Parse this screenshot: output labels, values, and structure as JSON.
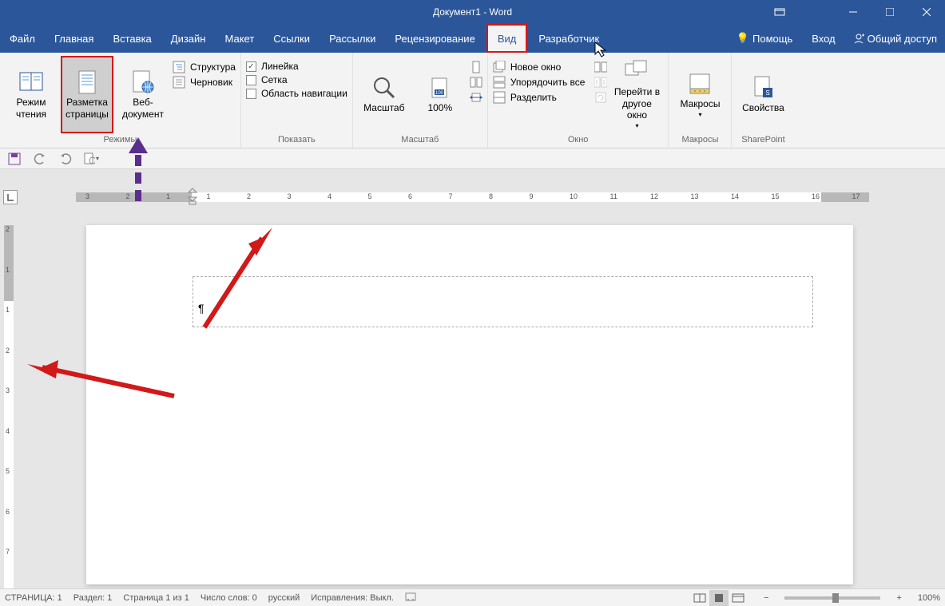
{
  "title": "Документ1 - Word",
  "menutabs": {
    "file": "Файл",
    "home": "Главная",
    "insert": "Вставка",
    "design": "Дизайн",
    "layout": "Макет",
    "references": "Ссылки",
    "mailings": "Рассылки",
    "review": "Рецензирование",
    "view": "Вид",
    "developer": "Разработчик"
  },
  "menuright": {
    "help": "Помощь",
    "login": "Вход",
    "share": "Общий доступ"
  },
  "ribbon": {
    "views_group_label": "Режимы",
    "read_mode": "Режим чтения",
    "print_layout": "Разметка страницы",
    "web_layout": "Веб-документ",
    "outline": "Структура",
    "draft": "Черновик",
    "show_group_label": "Показать",
    "ruler": "Линейка",
    "gridlines": "Сетка",
    "nav_pane": "Область навигации",
    "zoom_group_label": "Масштаб",
    "zoom": "Масштаб",
    "hundred": "100%",
    "window_group_label": "Окно",
    "new_window": "Новое окно",
    "arrange_all": "Упорядочить все",
    "split": "Разделить",
    "switch_windows": "Перейти в другое окно",
    "macros_label": "Макросы",
    "macros_group": "Макросы",
    "sharepoint_label": "Свойства",
    "sharepoint_group": "SharePoint"
  },
  "ruler_h": [
    "3",
    "2",
    "1",
    "1",
    "2",
    "3",
    "4",
    "5",
    "6",
    "7",
    "8",
    "9",
    "10",
    "11",
    "12",
    "13",
    "14",
    "15",
    "16",
    "17"
  ],
  "ruler_v": [
    "2",
    "1",
    "1",
    "2",
    "3",
    "4",
    "5",
    "6",
    "7"
  ],
  "status": {
    "page": "СТРАНИЦА: 1",
    "section": "Раздел: 1",
    "pages": "Страница 1 из 1",
    "words": "Число слов: 0",
    "language": "русский",
    "track": "Исправления: Выкл.",
    "zoom": "100%"
  },
  "doc": {
    "pilcrow": "¶"
  }
}
